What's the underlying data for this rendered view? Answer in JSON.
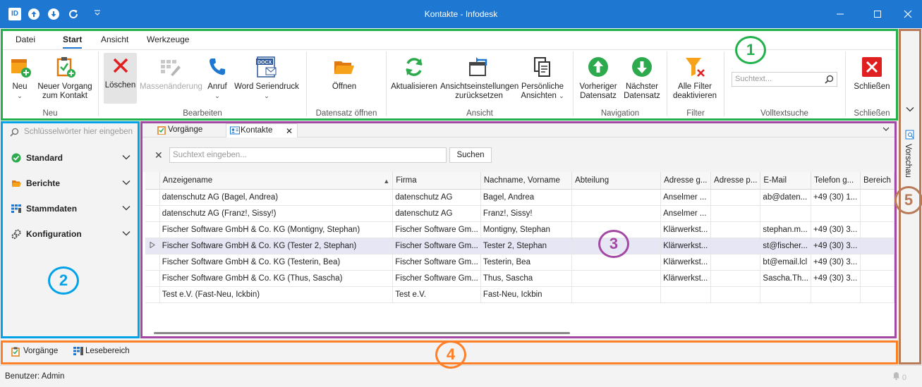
{
  "window": {
    "logo_text": "ID",
    "title": "Kontakte - Infodesk"
  },
  "ribbon": {
    "tabs": [
      "Datei",
      "Start",
      "Ansicht",
      "Werkzeuge"
    ],
    "active_tab": "Start",
    "buttons": {
      "neu": "Neu",
      "neuer_vorgang": "Neuer Vorgang zum Kontakt",
      "loeschen": "Löschen",
      "massenaenderung": "Massenänderung",
      "anruf": "Anruf",
      "word_seriendruck": "Word Seriendruck",
      "oeffnen": "Öffnen",
      "aktualisieren": "Aktualisieren",
      "ansicht_zuruecksetzen": "Ansichtseinstellungen zurücksetzen",
      "persoenliche_ansichten": "Persönliche Ansichten",
      "vorheriger": "Vorheriger Datensatz",
      "naechster": "Nächster Datensatz",
      "filter_aus": "Alle Filter deaktivieren",
      "schliessen": "Schließen"
    },
    "groups": {
      "neu": "Neu",
      "bearbeiten": "Bearbeiten",
      "datensatz_oeffnen": "Datensatz öffnen",
      "ansicht": "Ansicht",
      "navigation": "Navigation",
      "filter": "Filter",
      "volltextsuche": "Volltextsuche",
      "schliessen": "Schließen"
    },
    "search_placeholder": "Suchtext..."
  },
  "nav": {
    "keyword_placeholder": "Schlüsselwörter hier eingeben",
    "groups": [
      "Standard",
      "Berichte",
      "Stammdaten",
      "Konfiguration"
    ]
  },
  "doc_tabs": [
    "Vorgänge",
    "Kontakte"
  ],
  "filter": {
    "placeholder": "Suchtext eingeben...",
    "button": "Suchen"
  },
  "grid": {
    "columns": [
      "Anzeigename",
      "Firma",
      "Nachname, Vorname",
      "Abteilung",
      "Adresse g...",
      "Adresse p...",
      "E-Mail",
      "Telefon g...",
      "Bereich"
    ],
    "rows": [
      [
        "datenschutz AG (Bagel, Andrea)",
        "datenschutz AG",
        "Bagel, Andrea",
        "",
        "Anselmer ...",
        "",
        "ab@daten...",
        "+49 (30) 1...",
        ""
      ],
      [
        "datenschutz AG (Franz!, Sissy!)",
        "datenschutz AG",
        "Franz!, Sissy!",
        "",
        "Anselmer ...",
        "",
        "",
        "",
        ""
      ],
      [
        "Fischer Software GmbH & Co. KG (Montigny, Stephan)",
        "Fischer Software Gm...",
        "Montigny, Stephan",
        "",
        "Klärwerkst...",
        "",
        "stephan.m...",
        "+49 (30) 3...",
        ""
      ],
      [
        "Fischer Software GmbH & Co. KG (Tester 2, Stephan)",
        "Fischer Software Gm...",
        "Tester 2, Stephan",
        "",
        "Klärwerkst...",
        "",
        "st@fischer...",
        "+49 (30) 3...",
        ""
      ],
      [
        "Fischer Software GmbH & Co. KG (Testerin, Bea)",
        "Fischer Software Gm...",
        "Testerin, Bea",
        "",
        "Klärwerkst...",
        "",
        "bt@email.lcl",
        "+49 (30) 3...",
        ""
      ],
      [
        "Fischer Software GmbH & Co. KG (Thus, Sascha)",
        "Fischer Software Gm...",
        "Thus, Sascha",
        "",
        "Klärwerkst...",
        "",
        "Sascha.Th...",
        "+49 (30) 3...",
        ""
      ],
      [
        "Test e.V. (Fast-Neu, Ickbin)",
        "Test e.V.",
        "Fast-Neu, Ickbin",
        "",
        "",
        "",
        "",
        "",
        ""
      ]
    ],
    "selected_row": 3
  },
  "side_panel": {
    "label": "Vorschau"
  },
  "bottom_bar": [
    "Vorgänge",
    "Lesebereich"
  ],
  "status": {
    "user": "Benutzer: Admin",
    "notifications": "0"
  },
  "annotations": [
    "1",
    "2",
    "3",
    "4",
    "5"
  ],
  "colors": {
    "titlebar": "#1e78d2",
    "frame_1": "#22b14c",
    "frame_2": "#00a2e8",
    "frame_3": "#a349a4",
    "frame_4": "#ff7f27",
    "frame_5": "#b97a57"
  }
}
